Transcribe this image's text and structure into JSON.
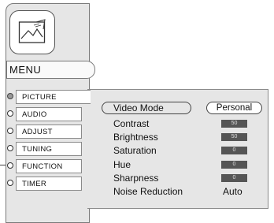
{
  "menu": {
    "title": "MENU",
    "icon": "picture-frame-icon",
    "items": [
      {
        "label": "PICTURE",
        "selected": true
      },
      {
        "label": "AUDIO",
        "selected": false
      },
      {
        "label": "ADJUST",
        "selected": false
      },
      {
        "label": "TUNING",
        "selected": false
      },
      {
        "label": "FUNCTION",
        "selected": false
      },
      {
        "label": "TIMER",
        "selected": false
      }
    ]
  },
  "picture": {
    "video_mode": {
      "label": "Video Mode",
      "value": "Personal"
    },
    "settings": [
      {
        "label": "Contrast",
        "value": "50"
      },
      {
        "label": "Brightness",
        "value": "50"
      },
      {
        "label": "Saturation",
        "value": "0"
      },
      {
        "label": "Hue",
        "value": "0"
      },
      {
        "label": "Sharpness",
        "value": "0"
      }
    ],
    "noise_reduction": {
      "label": "Noise Reduction",
      "value": "Auto"
    }
  },
  "colors": {
    "panel": "#e6e6e6",
    "border": "#7a7a7a",
    "bar": "#555555"
  }
}
